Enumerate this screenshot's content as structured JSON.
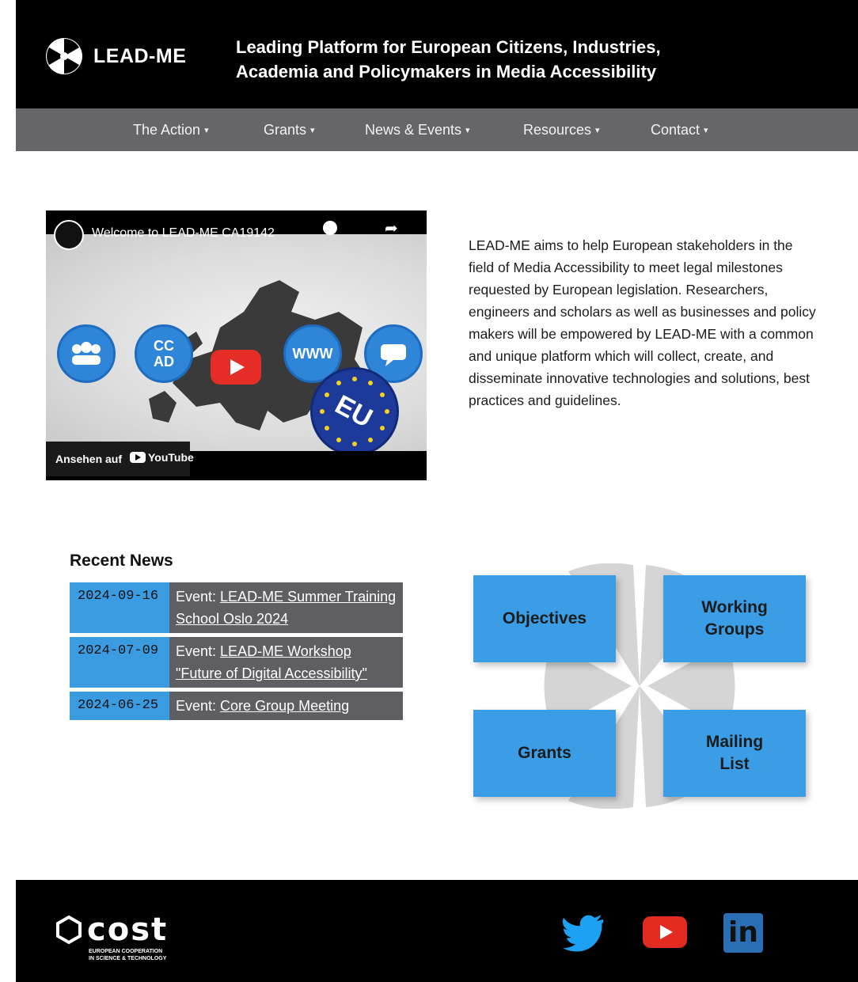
{
  "header": {
    "logo_text": "LEAD-ME",
    "tagline_line1": "Leading Platform for European Citizens, Industries,",
    "tagline_line2": "Academia and Policymakers in Media Accessibility"
  },
  "nav": {
    "items": [
      {
        "label": "The Action"
      },
      {
        "label": "Grants"
      },
      {
        "label": "News & Events"
      },
      {
        "label": "Resources"
      },
      {
        "label": "Contact"
      }
    ],
    "arrow": "▾"
  },
  "video": {
    "title": "Welcome to LEAD-ME CA19142",
    "watch_on": "Ansehen auf",
    "youtube_label": "YouTube",
    "eu_label": "EU",
    "cc_label": "CC",
    "ad_label": "AD",
    "www_label": "WWW"
  },
  "description": "LEAD-ME aims to help European stakeholders in the field of Media Accessibility to meet legal milestones requested by European legislation. Researchers, engineers and scholars as well as businesses and policy makers will be empowered by LEAD-ME with a common and unique platform which will collect, create, and disseminate innovative technologies and solutions, best practices and guidelines.",
  "news": {
    "heading": "Recent News",
    "rows": [
      {
        "date": "2024-09-16",
        "prefix": "Event:",
        "link": "LEAD-ME Summer Training School Oslo 2024"
      },
      {
        "date": "2024-07-09",
        "prefix": "Event:",
        "link": "LEAD-ME Workshop \"Future of Digital Accessibility\""
      },
      {
        "date": "2024-06-25",
        "prefix": "Event:",
        "link": "Core Group Meeting"
      }
    ]
  },
  "tiles": {
    "objectives": "Objectives",
    "working_groups": "Working Groups",
    "grants": "Grants",
    "mailing_list": "Mailing List"
  },
  "footer": {
    "cost_word": "cost",
    "cost_sub_line1": "EUROPEAN COOPERATION",
    "cost_sub_line2": "IN SCIENCE & TECHNOLOGY",
    "linkedin_label": "in"
  },
  "colors": {
    "header_bg": "#000000",
    "nav_bg": "#66656a",
    "accent_blue": "#3a9de6",
    "news_body_bg": "#5f5e63",
    "youtube_red": "#e32b22",
    "twitter_blue": "#1da1f2",
    "linkedin_blue": "#2a6fb3"
  }
}
